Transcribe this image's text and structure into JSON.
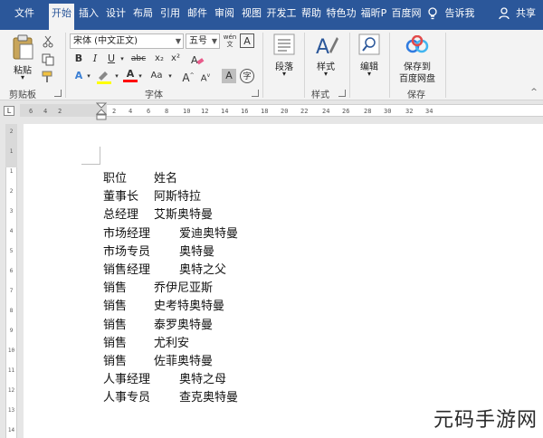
{
  "tabs": [
    {
      "label": "文件"
    },
    {
      "label": "开始"
    },
    {
      "label": "插入"
    },
    {
      "label": "设计"
    },
    {
      "label": "布局"
    },
    {
      "label": "引用"
    },
    {
      "label": "邮件"
    },
    {
      "label": "审阅"
    },
    {
      "label": "视图"
    },
    {
      "label": "开发工"
    },
    {
      "label": "帮助"
    },
    {
      "label": "特色功"
    },
    {
      "label": "福昕P"
    },
    {
      "label": "百度网"
    }
  ],
  "tell_me": "告诉我",
  "share": "共享",
  "clipboard": {
    "paste": "粘贴",
    "group": "剪贴板"
  },
  "font": {
    "name": "宋体 (中文正文)",
    "size": "五号",
    "group": "字体",
    "wen": "wén",
    "A_box": "A",
    "bold": "B",
    "italic": "I",
    "underline": "U",
    "strike": "abc",
    "sub": "x₂",
    "sup": "x²",
    "fx_a": "A",
    "color_a": "A",
    "aa": "Aa",
    "grow": "A",
    "shrink": "A",
    "char_shade": "A",
    "circle": "字"
  },
  "paragraph": {
    "label": "段落"
  },
  "styles": {
    "label": "样式",
    "group": "样式"
  },
  "editing": {
    "label": "编辑"
  },
  "save": {
    "line1": "保存到",
    "line2": "百度网盘",
    "group": "保存"
  },
  "ruler": {
    "tab_marker": "L",
    "ticks": [
      "6",
      "4",
      "2",
      "2",
      "4",
      "6",
      "8",
      "10",
      "12",
      "14",
      "16",
      "18",
      "20",
      "22",
      "24",
      "26",
      "28",
      "30",
      "32",
      "34"
    ],
    "vticks": [
      "2",
      "1",
      "1",
      "2",
      "3",
      "4",
      "5",
      "6",
      "7",
      "8",
      "9",
      "10",
      "11",
      "12",
      "13",
      "14"
    ]
  },
  "document": {
    "rows": [
      {
        "title": "职位",
        "name": "姓名"
      },
      {
        "title": "董事长",
        "name": "阿斯特拉"
      },
      {
        "title": "总经理",
        "name": "艾斯奥特曼"
      },
      {
        "title": "市场经理",
        "name": "爱迪奥特曼"
      },
      {
        "title": "市场专员",
        "name": "奥特曼"
      },
      {
        "title": "销售经理",
        "name": "奥特之父"
      },
      {
        "title": "销售",
        "name": "乔伊尼亚斯"
      },
      {
        "title": "销售",
        "name": "史考特奥特曼"
      },
      {
        "title": "销售",
        "name": "泰罗奥特曼"
      },
      {
        "title": "销售",
        "name": "尤利安"
      },
      {
        "title": "销售",
        "name": "佐菲奥特曼"
      },
      {
        "title": "人事经理",
        "name": "奥特之母"
      },
      {
        "title": "人事专员",
        "name": "查克奥特曼"
      }
    ]
  },
  "watermark": "元码手游网",
  "colors": {
    "ribbon_blue": "#2b579a",
    "highlight_yellow": "#ffff00",
    "font_red": "#ff0000",
    "paste_icon": "#c8a55a"
  }
}
